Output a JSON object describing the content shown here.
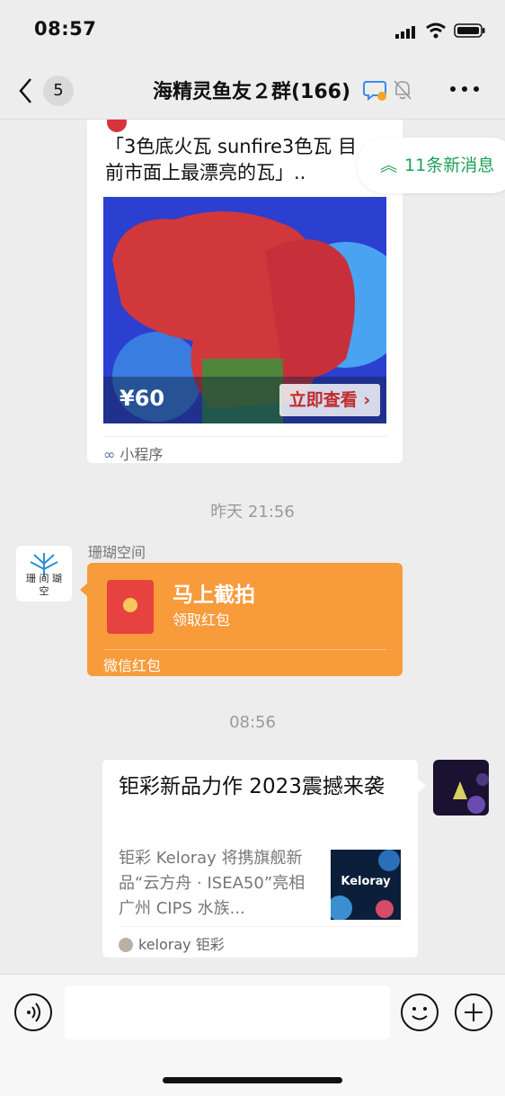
{
  "status_bar": {
    "time": "08:57"
  },
  "nav": {
    "back_count": "5",
    "title": "海精灵鱼友２群(166)"
  },
  "new_messages": {
    "label": "11条新消息"
  },
  "mini_program_card": {
    "title": "「3色底火瓦 sunfire3色瓦 目前市面上最漂亮的瓦」..",
    "price": "¥60",
    "buy_label": "立即查看",
    "footer": "小程序"
  },
  "timestamps": [
    "昨天 21:56",
    "08:56"
  ],
  "red_packet_msg": {
    "sender": "珊瑚空间",
    "avatar_text": "珊 间 瑚 空",
    "title": "马上截拍",
    "subtitle": "领取红包",
    "footer": "微信红包"
  },
  "article_msg": {
    "title": "钜彩新品力作 2023震撼来袭",
    "desc": "钜彩 Keloray 将携旗舰新品“云方舟 · ISEA50”亮相广州 CIPS 水族...",
    "thumb_text": "Keloray",
    "source": "keloray 钜彩"
  },
  "colors": {
    "accent_green": "#1f9f58",
    "red_packet": "#f79b3b",
    "price_red": "#c22a2a"
  }
}
